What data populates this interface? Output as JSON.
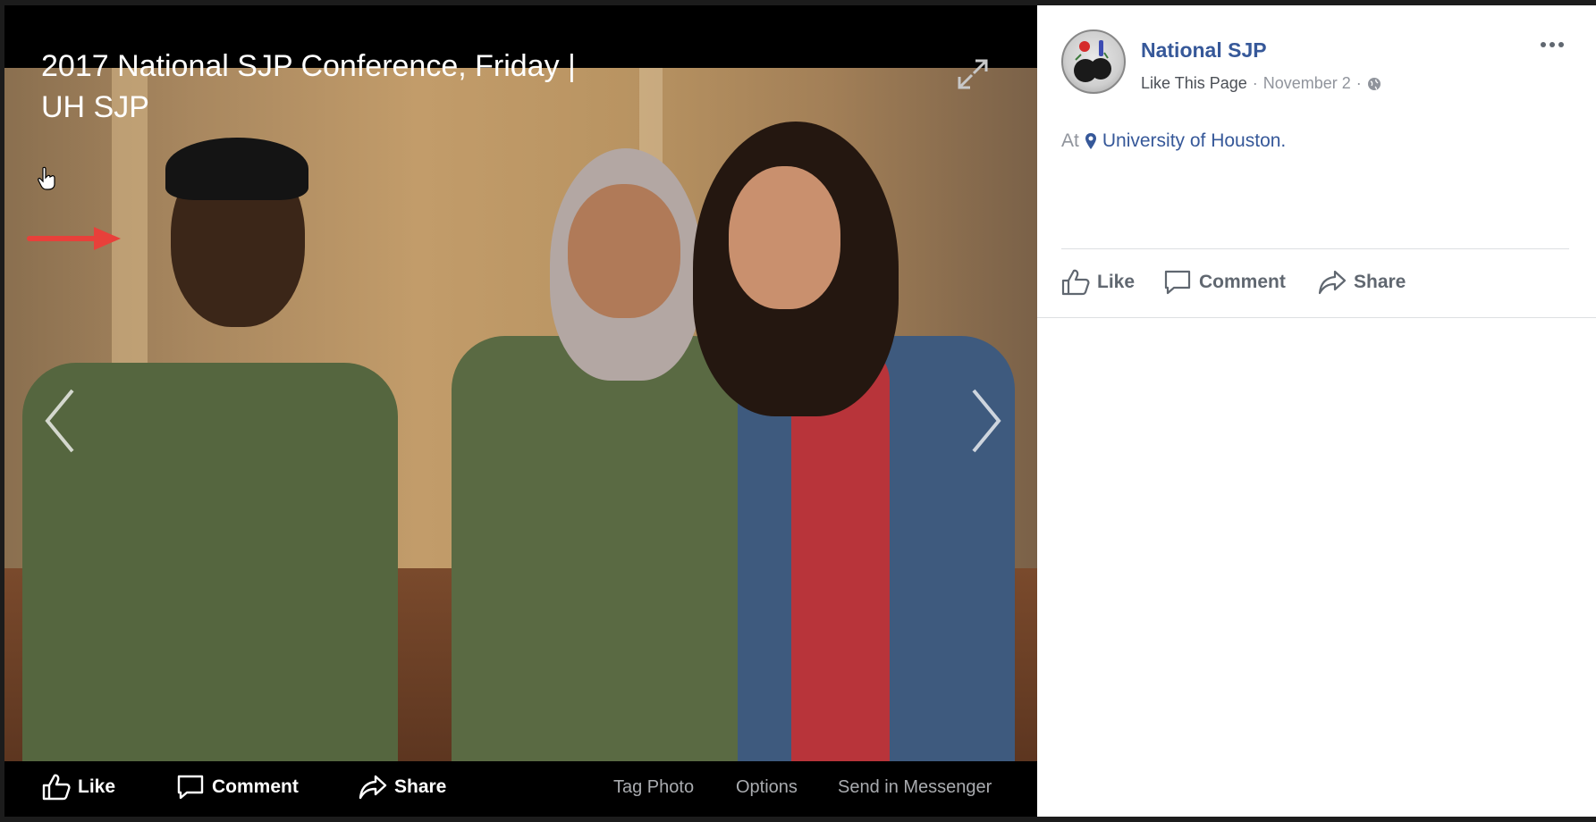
{
  "photo_viewer": {
    "title": "2017 National SJP Conference, Friday | UH SJP",
    "actions": {
      "like_label": "Like",
      "comment_label": "Comment",
      "share_label": "Share"
    },
    "options": {
      "tag_photo": "Tag Photo",
      "options": "Options",
      "send_messenger": "Send in Messenger"
    },
    "icons": [
      "expand-icon",
      "previous-arrow-icon",
      "next-arrow-icon",
      "like-icon",
      "comment-icon",
      "share-icon",
      "red-arrow-icon",
      "hand-cursor-icon"
    ]
  },
  "post": {
    "page_name": "National SJP",
    "like_page": "Like This Page",
    "date": "November 2",
    "separator": "·",
    "location_prefix": "At",
    "location": "University of Houston.",
    "actions": {
      "like_label": "Like",
      "comment_label": "Comment",
      "share_label": "Share"
    },
    "icons": [
      "avatar",
      "globe-icon",
      "more-options-icon",
      "location-pin-icon"
    ],
    "colors": {
      "link": "#365899",
      "secondary": "#90949c",
      "action": "#606770"
    }
  }
}
